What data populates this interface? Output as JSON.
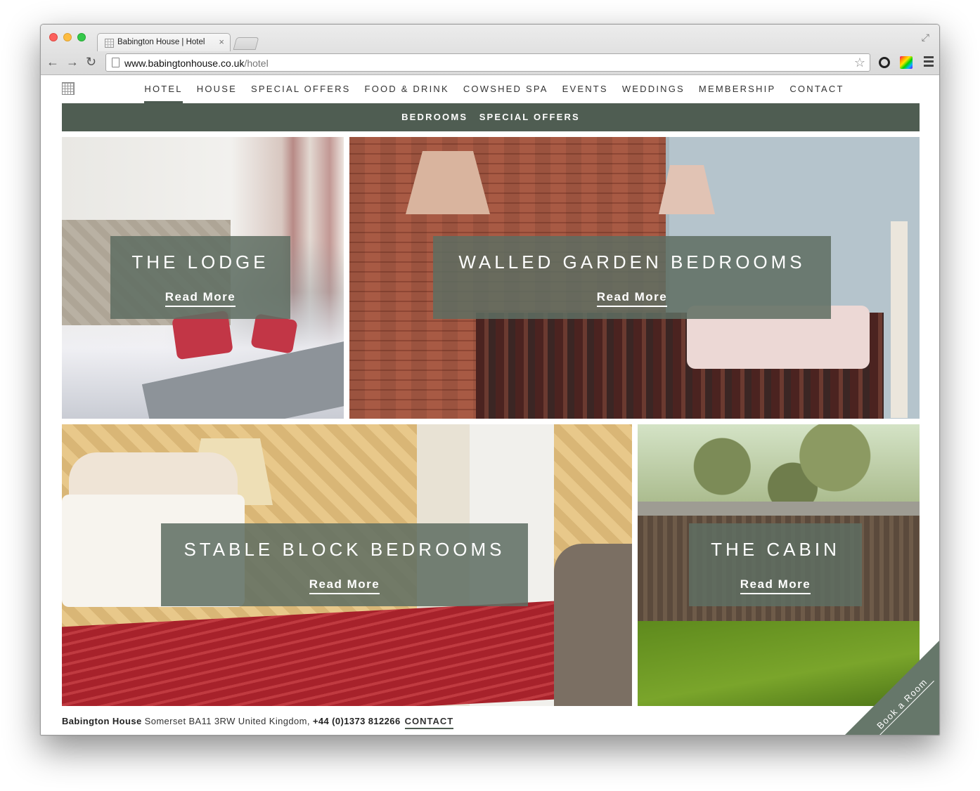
{
  "browser": {
    "tab_title": "Babington House | Hotel",
    "tab_close": "×",
    "url_host": "www.babingtonhouse.co.uk",
    "url_path": "/hotel",
    "back_icon": "←",
    "forward_icon": "→",
    "reload_icon": "↻",
    "star_icon": "☆",
    "fullscreen_icon": "⤢"
  },
  "nav": {
    "items": [
      {
        "label": "HOTEL"
      },
      {
        "label": "HOUSE"
      },
      {
        "label": "SPECIAL OFFERS"
      },
      {
        "label": "FOOD & DRINK"
      },
      {
        "label": "COWSHED SPA"
      },
      {
        "label": "EVENTS"
      },
      {
        "label": "WEDDINGS"
      },
      {
        "label": "MEMBERSHIP"
      },
      {
        "label": "CONTACT"
      }
    ],
    "active": "HOTEL"
  },
  "subnav": {
    "items": [
      {
        "label": "BEDROOMS"
      },
      {
        "label": "SPECIAL OFFERS"
      }
    ]
  },
  "tiles": [
    {
      "title": "THE LODGE",
      "link": "Read More"
    },
    {
      "title": "WALLED GARDEN BEDROOMS",
      "link": "Read More"
    },
    {
      "title": "STABLE BLOCK BEDROOMS",
      "link": "Read More"
    },
    {
      "title": "THE CABIN",
      "link": "Read More"
    }
  ],
  "footer": {
    "name": "Babington House",
    "address": " Somerset BA11 3RW United Kingdom, ",
    "phone": "+44 (0)1373 812266",
    "contact": "CONTACT"
  },
  "book": {
    "label": "Book a Room"
  },
  "colors": {
    "accent": "#4f5d52",
    "overlay": "#5e6e62"
  }
}
